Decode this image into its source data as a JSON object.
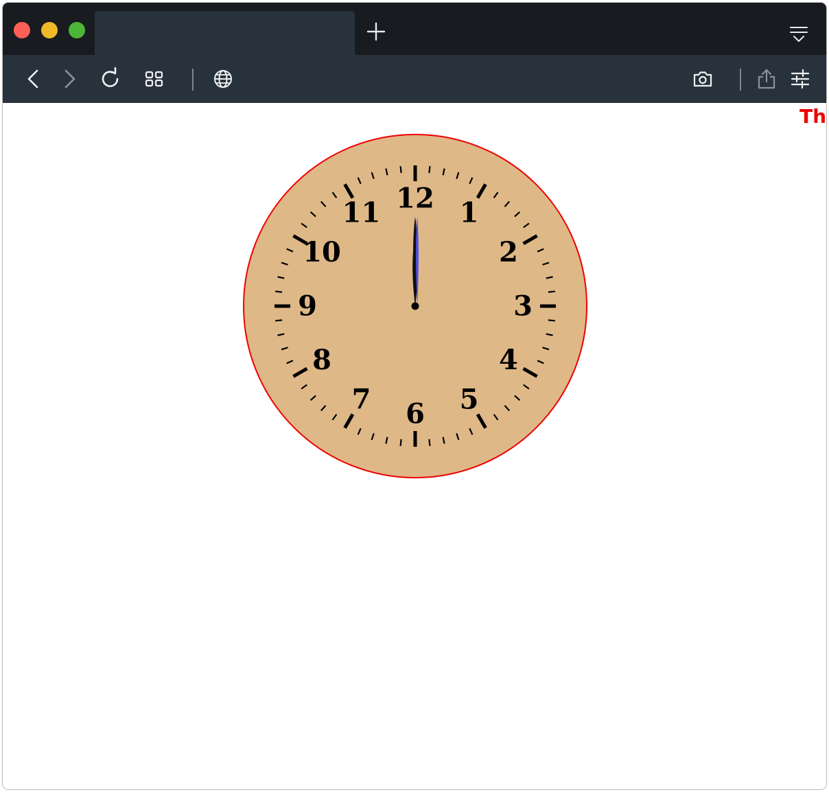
{
  "browser": {
    "tab_title": "",
    "colors": {
      "titlebar": "#181b1f",
      "toolbar": "#28323c",
      "close": "#fe5f57",
      "minimize": "#f0b927",
      "zoom": "#4db638"
    },
    "icons": {
      "new_tab": "plus-icon",
      "tab_menu": "tab-list-icon",
      "back": "chevron-left-icon",
      "forward": "chevron-right-icon",
      "reload": "reload-icon",
      "tabs_overview": "grid-icon",
      "site": "globe-icon",
      "screenshot": "camera-icon",
      "share": "share-icon",
      "settings": "sliders-icon"
    }
  },
  "page": {
    "clipped_text": "Th",
    "clipped_text_color": "#ee0000",
    "clock": {
      "face_color": "#deb887",
      "border_color": "#ee0000",
      "numerals": [
        "12",
        "1",
        "2",
        "3",
        "4",
        "5",
        "6",
        "7",
        "8",
        "9",
        "10",
        "11"
      ],
      "time": {
        "hour": 12,
        "minute": 0,
        "second": 0
      },
      "second_hand_color": "#5050dd"
    }
  }
}
